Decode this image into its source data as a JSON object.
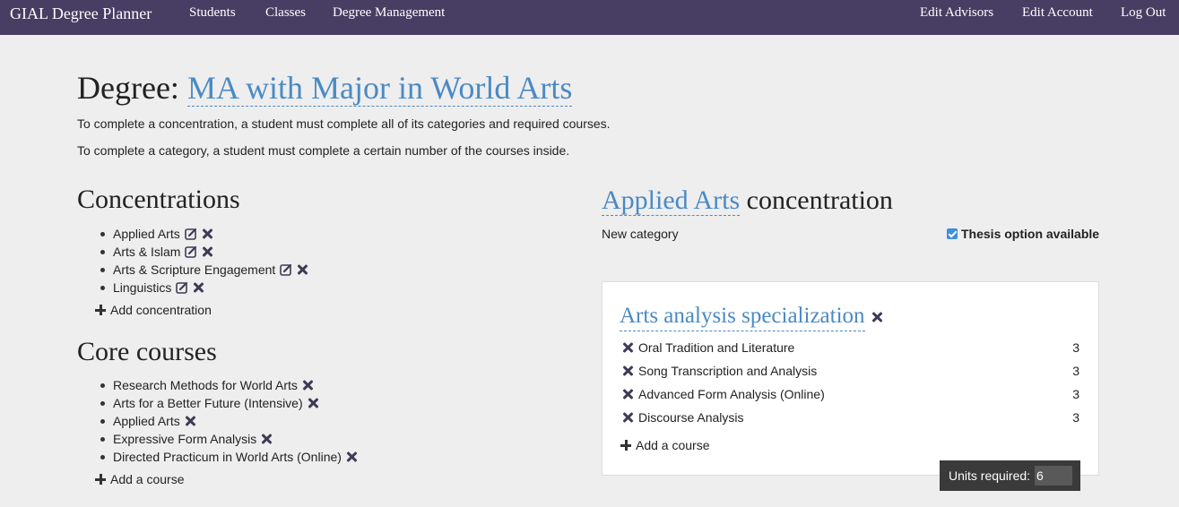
{
  "nav": {
    "brand": "GIAL Degree Planner",
    "left_items": [
      "Students",
      "Classes",
      "Degree Management"
    ],
    "right_items": [
      "Edit Advisors",
      "Edit Account",
      "Log Out"
    ]
  },
  "degree": {
    "label": "Degree:",
    "name": "MA with Major in World Arts",
    "info1": "To complete a concentration, a student must complete all of its categories and required courses.",
    "info2": "To complete a category, a student must complete a certain number of the courses inside."
  },
  "concentrations": {
    "heading": "Concentrations",
    "items": [
      "Applied Arts",
      "Arts & Islam",
      "Arts & Scripture Engagement",
      "Linguistics"
    ],
    "add_label": "Add concentration"
  },
  "core": {
    "heading": "Core courses",
    "items": [
      "Research Methods for World Arts",
      "Arts for a Better Future (Intensive)",
      "Applied Arts",
      "Expressive Form Analysis",
      "Directed Practicum in World Arts (Online)"
    ],
    "add_label": "Add a course"
  },
  "concentration_detail": {
    "name": "Applied Arts",
    "suffix": "concentration",
    "new_category": "New category",
    "thesis_label": "Thesis option available",
    "thesis_checked": true
  },
  "category": {
    "name": "Arts analysis specialization",
    "courses": [
      {
        "name": "Oral Tradition and Literature",
        "units": "3"
      },
      {
        "name": "Song Transcription and Analysis",
        "units": "3"
      },
      {
        "name": "Advanced Form Analysis (Online)",
        "units": "3"
      },
      {
        "name": "Discourse Analysis",
        "units": "3"
      }
    ],
    "add_label": "Add a course",
    "units_required_label": "Units required:",
    "units_required_value": "6"
  },
  "colors": {
    "navbar": "#483d62",
    "link": "#4a8ac4",
    "background": "#eeeeee",
    "checkbox": "#3d8fe0"
  }
}
